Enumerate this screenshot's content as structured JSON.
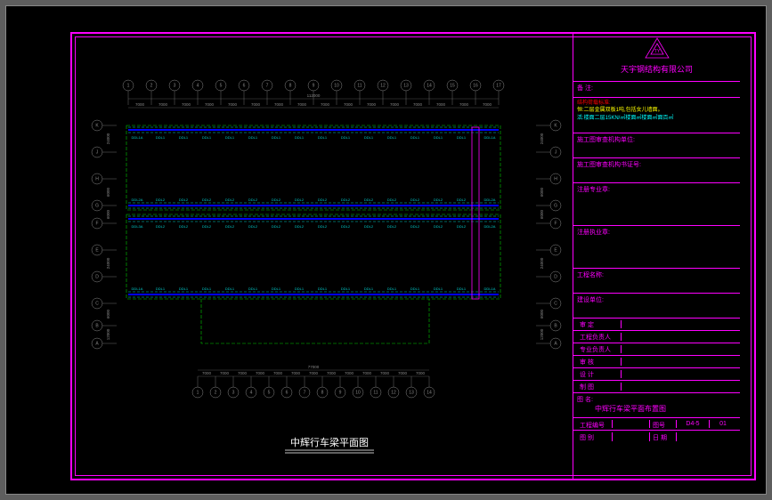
{
  "company": "天宇钢结构有限公司",
  "titleblock": {
    "remark_label": "备  注:",
    "spec_l1": "结构荷载标准:",
    "spec_l2": "恒:二层金属双板1吨,包括女儿墙面。",
    "spec_l3": "活:楼面二层15KN/㎡楼面㎡楼面㎡面百㎡",
    "row1": "施工图审查机构单位:",
    "row2": "施工图审查机构书证号:",
    "row3": "注册专业章:",
    "row4": "注册执业章:",
    "row5": "工程名称:",
    "row6": "建设单位:",
    "row7a": "审  定",
    "row8a": "工程负责人",
    "row9a": "专业负责人",
    "row10a": "审  核",
    "row11a": "设  计",
    "row12a": "制  图",
    "drawing_name_label": "图  名:",
    "drawing_name": "中辉行车梁平面布置图",
    "proj_label": "工程编号",
    "sheet_label": "图号",
    "sheet_val": "D4-5",
    "rev_label": "图  别",
    "rev_val": "01",
    "date_label": "日 期"
  },
  "title": "中辉行车梁平面图",
  "grid_h_top": [
    "1",
    "2",
    "3",
    "4",
    "5",
    "6",
    "7",
    "8",
    "9",
    "10",
    "11",
    "12",
    "13",
    "14",
    "15",
    "16",
    "17"
  ],
  "grid_h_bot": [
    "1",
    "2",
    "3",
    "4",
    "5",
    "6",
    "7",
    "8",
    "9",
    "10",
    "11",
    "12",
    "13",
    "14"
  ],
  "grid_v": [
    "K",
    "J",
    "H",
    "G",
    "F",
    "E",
    "D",
    "C",
    "B",
    "A"
  ],
  "dim_7000": "7000",
  "dim_total_top": "112000",
  "dim_total_bot": "77000",
  "dim_v": [
    "12000",
    "6000",
    "24000",
    "6000",
    "6000",
    "24000"
  ],
  "beam_labels": [
    "DDL1A",
    "DDL1",
    "DDL2",
    "DDL2A",
    "DDL3",
    "DDL3A"
  ]
}
